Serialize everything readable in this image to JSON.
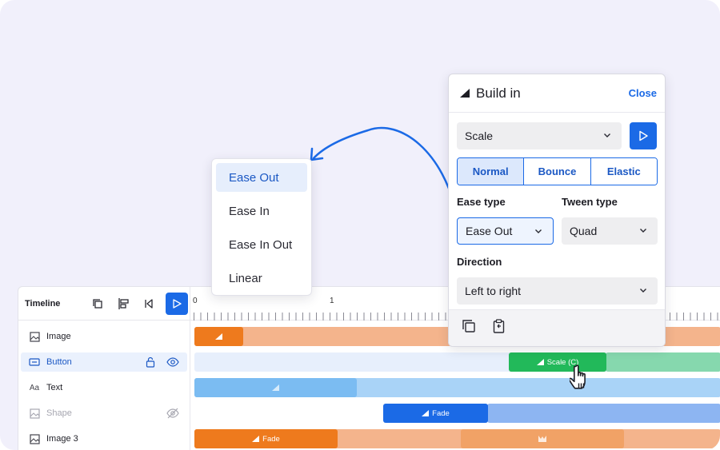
{
  "timeline": {
    "title": "Timeline",
    "ruler": [
      "0",
      "1"
    ],
    "layers": [
      {
        "label": "Image",
        "icon": "image-icon"
      },
      {
        "label": "Button",
        "icon": "button-icon",
        "selected": true
      },
      {
        "label": "Text",
        "icon": "text-icon"
      },
      {
        "label": "Shape",
        "icon": "image-icon",
        "hidden": true
      },
      {
        "label": "Image 3",
        "icon": "image-icon"
      }
    ],
    "bars": {
      "scale_label": "Scale (C)",
      "fade_label_1": "Fade",
      "fade_label_2": "Fade"
    }
  },
  "build_in": {
    "title": "Build in",
    "close_label": "Close",
    "effect": "Scale",
    "modes": [
      "Normal",
      "Bounce",
      "Elastic"
    ],
    "selected_mode": "Normal",
    "ease_type_label": "Ease type",
    "ease_type_value": "Ease Out",
    "tween_type_label": "Tween type",
    "tween_type_value": "Quad",
    "direction_label": "Direction",
    "direction_value": "Left to right"
  },
  "ease_dropdown": {
    "options": [
      "Ease Out",
      "Ease In",
      "Ease In Out",
      "Linear"
    ],
    "selected": "Ease Out"
  },
  "colors": {
    "accent": "#1b6ae6",
    "orange": "#ee7a1d",
    "orange_light": "#f4b48c",
    "green": "#22b95a",
    "green_light": "#86d8ae",
    "blue_light": "#7bbcf2",
    "blue_bar": "#1b6ae6"
  }
}
